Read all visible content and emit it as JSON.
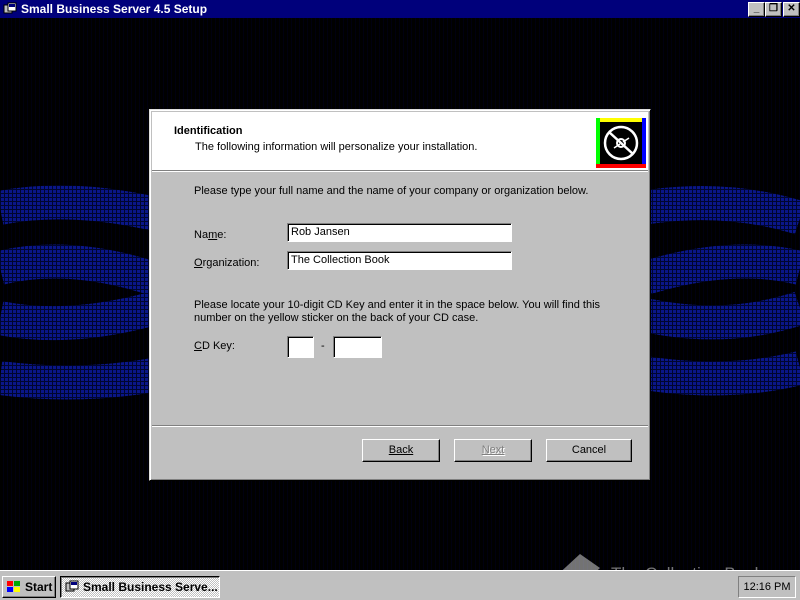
{
  "window": {
    "title": "Small Business Server 4.5 Setup",
    "controls": {
      "minimize": "_",
      "maximize": "❐",
      "close": "✕"
    }
  },
  "dialog": {
    "header_title": "Identification",
    "header_subtitle": "The following information will personalize your installation.",
    "intro": "Please type your full name and the name of your company or organization below.",
    "name_label": "Name:",
    "name_value": "Rob Jansen",
    "org_label": "Organization:",
    "org_value": "The Collection Book",
    "cd_instructions_line1": "Please locate your 10-digit CD Key and enter it in the space below. You will find this",
    "cd_instructions_line2": "number on the yellow sticker on the back of your CD case.",
    "cd_label": "CD Key:",
    "cd_key_part1": "",
    "cd_key_separator": "-",
    "cd_key_part2": "",
    "buttons": {
      "back": "Back",
      "next": "Next",
      "cancel": "Cancel"
    }
  },
  "taskbar": {
    "start_label": "Start",
    "task_label": "Small Business Serve...",
    "clock": "12:16 PM"
  },
  "watermark": "The Collection Book"
}
